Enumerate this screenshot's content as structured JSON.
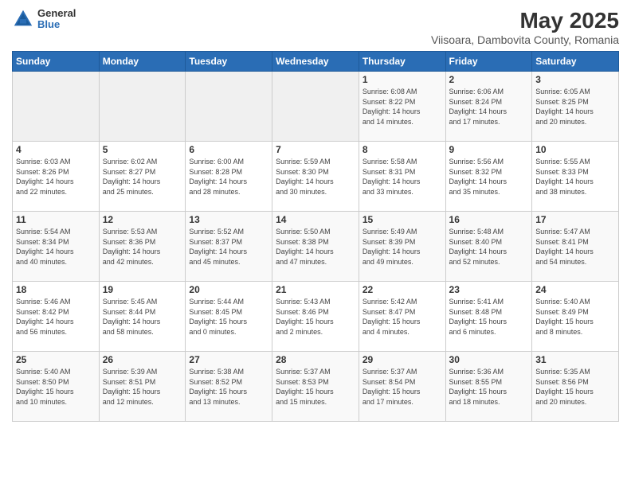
{
  "header": {
    "logo_general": "General",
    "logo_blue": "Blue",
    "title": "May 2025",
    "subtitle": "Viisoara, Dambovita County, Romania"
  },
  "days_of_week": [
    "Sunday",
    "Monday",
    "Tuesday",
    "Wednesday",
    "Thursday",
    "Friday",
    "Saturday"
  ],
  "weeks": [
    [
      {
        "num": "",
        "info": ""
      },
      {
        "num": "",
        "info": ""
      },
      {
        "num": "",
        "info": ""
      },
      {
        "num": "",
        "info": ""
      },
      {
        "num": "1",
        "info": "Sunrise: 6:08 AM\nSunset: 8:22 PM\nDaylight: 14 hours\nand 14 minutes."
      },
      {
        "num": "2",
        "info": "Sunrise: 6:06 AM\nSunset: 8:24 PM\nDaylight: 14 hours\nand 17 minutes."
      },
      {
        "num": "3",
        "info": "Sunrise: 6:05 AM\nSunset: 8:25 PM\nDaylight: 14 hours\nand 20 minutes."
      }
    ],
    [
      {
        "num": "4",
        "info": "Sunrise: 6:03 AM\nSunset: 8:26 PM\nDaylight: 14 hours\nand 22 minutes."
      },
      {
        "num": "5",
        "info": "Sunrise: 6:02 AM\nSunset: 8:27 PM\nDaylight: 14 hours\nand 25 minutes."
      },
      {
        "num": "6",
        "info": "Sunrise: 6:00 AM\nSunset: 8:28 PM\nDaylight: 14 hours\nand 28 minutes."
      },
      {
        "num": "7",
        "info": "Sunrise: 5:59 AM\nSunset: 8:30 PM\nDaylight: 14 hours\nand 30 minutes."
      },
      {
        "num": "8",
        "info": "Sunrise: 5:58 AM\nSunset: 8:31 PM\nDaylight: 14 hours\nand 33 minutes."
      },
      {
        "num": "9",
        "info": "Sunrise: 5:56 AM\nSunset: 8:32 PM\nDaylight: 14 hours\nand 35 minutes."
      },
      {
        "num": "10",
        "info": "Sunrise: 5:55 AM\nSunset: 8:33 PM\nDaylight: 14 hours\nand 38 minutes."
      }
    ],
    [
      {
        "num": "11",
        "info": "Sunrise: 5:54 AM\nSunset: 8:34 PM\nDaylight: 14 hours\nand 40 minutes."
      },
      {
        "num": "12",
        "info": "Sunrise: 5:53 AM\nSunset: 8:36 PM\nDaylight: 14 hours\nand 42 minutes."
      },
      {
        "num": "13",
        "info": "Sunrise: 5:52 AM\nSunset: 8:37 PM\nDaylight: 14 hours\nand 45 minutes."
      },
      {
        "num": "14",
        "info": "Sunrise: 5:50 AM\nSunset: 8:38 PM\nDaylight: 14 hours\nand 47 minutes."
      },
      {
        "num": "15",
        "info": "Sunrise: 5:49 AM\nSunset: 8:39 PM\nDaylight: 14 hours\nand 49 minutes."
      },
      {
        "num": "16",
        "info": "Sunrise: 5:48 AM\nSunset: 8:40 PM\nDaylight: 14 hours\nand 52 minutes."
      },
      {
        "num": "17",
        "info": "Sunrise: 5:47 AM\nSunset: 8:41 PM\nDaylight: 14 hours\nand 54 minutes."
      }
    ],
    [
      {
        "num": "18",
        "info": "Sunrise: 5:46 AM\nSunset: 8:42 PM\nDaylight: 14 hours\nand 56 minutes."
      },
      {
        "num": "19",
        "info": "Sunrise: 5:45 AM\nSunset: 8:44 PM\nDaylight: 14 hours\nand 58 minutes."
      },
      {
        "num": "20",
        "info": "Sunrise: 5:44 AM\nSunset: 8:45 PM\nDaylight: 15 hours\nand 0 minutes."
      },
      {
        "num": "21",
        "info": "Sunrise: 5:43 AM\nSunset: 8:46 PM\nDaylight: 15 hours\nand 2 minutes."
      },
      {
        "num": "22",
        "info": "Sunrise: 5:42 AM\nSunset: 8:47 PM\nDaylight: 15 hours\nand 4 minutes."
      },
      {
        "num": "23",
        "info": "Sunrise: 5:41 AM\nSunset: 8:48 PM\nDaylight: 15 hours\nand 6 minutes."
      },
      {
        "num": "24",
        "info": "Sunrise: 5:40 AM\nSunset: 8:49 PM\nDaylight: 15 hours\nand 8 minutes."
      }
    ],
    [
      {
        "num": "25",
        "info": "Sunrise: 5:40 AM\nSunset: 8:50 PM\nDaylight: 15 hours\nand 10 minutes."
      },
      {
        "num": "26",
        "info": "Sunrise: 5:39 AM\nSunset: 8:51 PM\nDaylight: 15 hours\nand 12 minutes."
      },
      {
        "num": "27",
        "info": "Sunrise: 5:38 AM\nSunset: 8:52 PM\nDaylight: 15 hours\nand 13 minutes."
      },
      {
        "num": "28",
        "info": "Sunrise: 5:37 AM\nSunset: 8:53 PM\nDaylight: 15 hours\nand 15 minutes."
      },
      {
        "num": "29",
        "info": "Sunrise: 5:37 AM\nSunset: 8:54 PM\nDaylight: 15 hours\nand 17 minutes."
      },
      {
        "num": "30",
        "info": "Sunrise: 5:36 AM\nSunset: 8:55 PM\nDaylight: 15 hours\nand 18 minutes."
      },
      {
        "num": "31",
        "info": "Sunrise: 5:35 AM\nSunset: 8:56 PM\nDaylight: 15 hours\nand 20 minutes."
      }
    ]
  ]
}
